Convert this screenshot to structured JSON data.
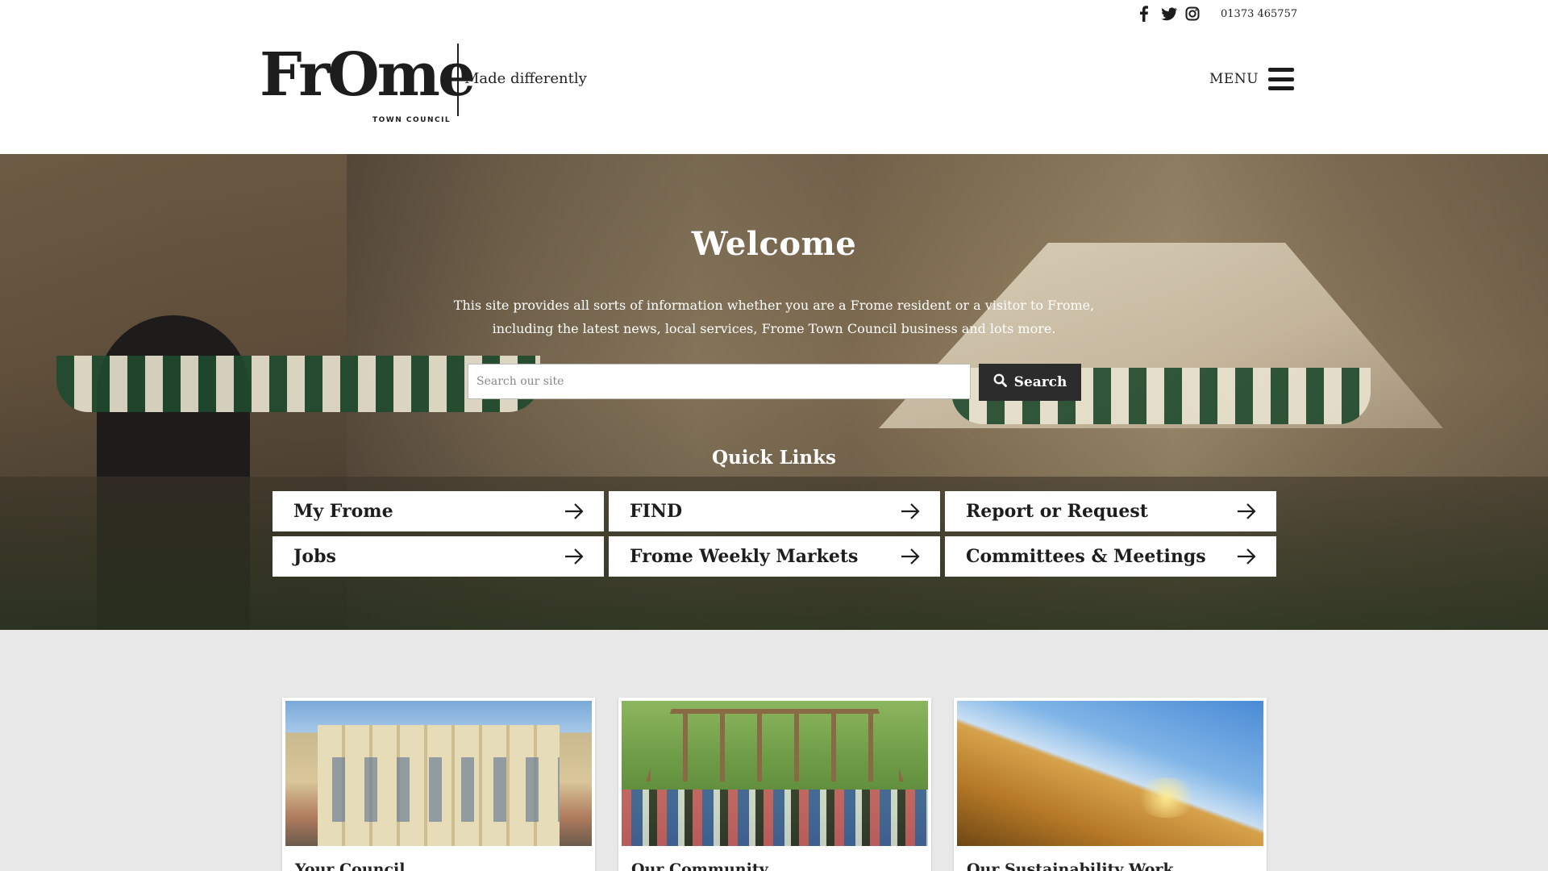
{
  "topbar": {
    "social_icons": [
      "facebook-icon",
      "twitter-icon",
      "instagram-icon"
    ],
    "phone": "01373 465757"
  },
  "header": {
    "logo_text": "FrOme",
    "logo_subtext": "TOWN COUNCIL",
    "tagline": "Made differently",
    "menu_label": "MENU"
  },
  "hero": {
    "title": "Welcome",
    "intro": "This site provides all sorts of information whether you are a Frome resident or a visitor to Frome, including the latest news, local services, Frome Town Council business and lots more.",
    "search": {
      "placeholder": "Search our site",
      "value": "",
      "button_label": "Search"
    },
    "quick_links_title": "Quick Links",
    "quick_links": [
      {
        "label": "My Frome"
      },
      {
        "label": "FIND"
      },
      {
        "label": "Report or Request"
      },
      {
        "label": "Jobs"
      },
      {
        "label": "Frome Weekly Markets"
      },
      {
        "label": "Committees & Meetings"
      }
    ]
  },
  "cards": [
    {
      "title": "Your Council"
    },
    {
      "title": "Our Community"
    },
    {
      "title": "Our Sustainability Work"
    }
  ],
  "colors": {
    "text": "#1d1d1d",
    "search_button": "#2c2c2c",
    "content_bg": "#e8e8e8",
    "white": "#ffffff"
  }
}
